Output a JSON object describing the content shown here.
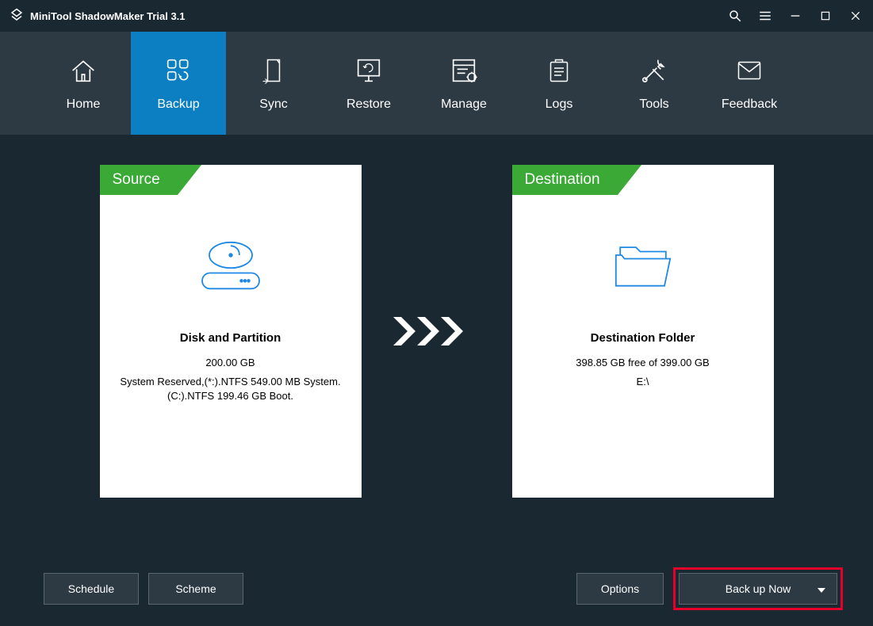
{
  "titlebar": {
    "title": "MiniTool ShadowMaker Trial 3.1"
  },
  "nav": {
    "items": [
      {
        "label": "Home"
      },
      {
        "label": "Backup"
      },
      {
        "label": "Sync"
      },
      {
        "label": "Restore"
      },
      {
        "label": "Manage"
      },
      {
        "label": "Logs"
      },
      {
        "label": "Tools"
      },
      {
        "label": "Feedback"
      }
    ]
  },
  "source": {
    "tab": "Source",
    "title": "Disk and Partition",
    "size": "200.00 GB",
    "details": "System Reserved,(*:).NTFS 549.00 MB System. (C:).NTFS 199.46 GB Boot."
  },
  "destination": {
    "tab": "Destination",
    "title": "Destination Folder",
    "free": "398.85 GB free of 399.00 GB",
    "path": "E:\\"
  },
  "buttons": {
    "schedule": "Schedule",
    "scheme": "Scheme",
    "options": "Options",
    "backup_now": "Back up Now"
  }
}
